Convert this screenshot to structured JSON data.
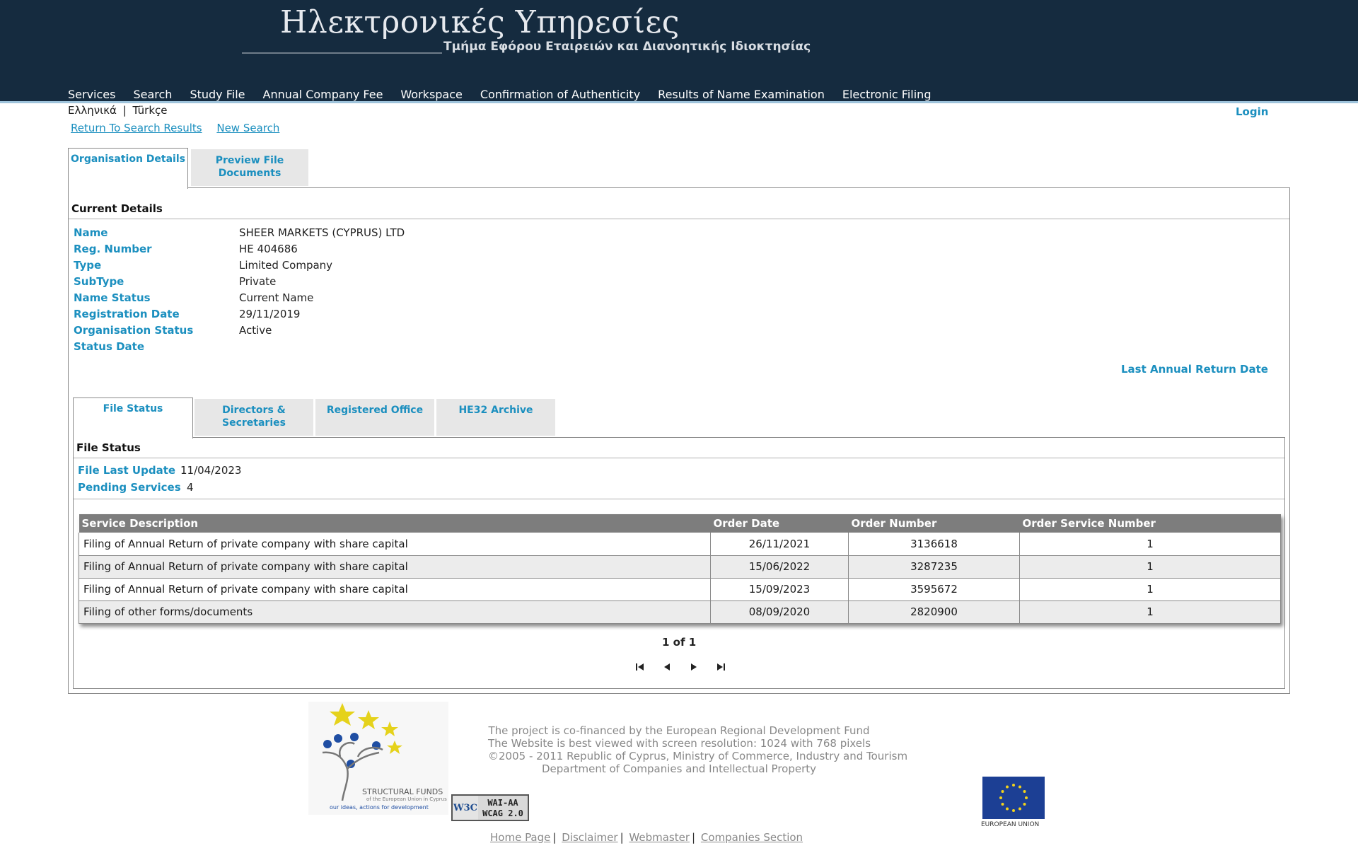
{
  "header": {
    "title": "Ηλεκτρονικές Υπηρεσίες",
    "subtitle": "Τμήμα Εφόρου Εταιρειών και Διανοητικής Ιδιοκτησίας",
    "nav": [
      "Services",
      "Search",
      "Study File",
      "Annual Company Fee",
      "Workspace",
      "Confirmation of Authenticity",
      "Results of Name Examination",
      "Electronic Filing"
    ]
  },
  "lang": {
    "greek": "Ελληνικά",
    "sep": "|",
    "turkish": "Türkçe"
  },
  "login": "Login",
  "links": {
    "return": "Return To Search Results",
    "new_search": "New Search"
  },
  "outer_tabs": {
    "org_details": "Organisation Details",
    "preview_docs_1": "Preview File",
    "preview_docs_2": "Documents"
  },
  "current_details": {
    "heading": "Current Details",
    "labels": [
      "Name",
      "Reg. Number",
      "Type",
      "SubType",
      "Name Status",
      "Registration Date",
      "Organisation Status",
      "Status Date"
    ],
    "values": [
      "SHEER MARKETS (CYPRUS) LTD",
      "HE 404686",
      "Limited Company",
      "Private",
      "Current Name",
      "29/11/2019",
      "Active",
      ""
    ],
    "last_annual_return": "Last Annual Return Date"
  },
  "inner_tabs": [
    "File Status",
    "Directors & Secretaries",
    "Registered Office",
    "HE32 Archive"
  ],
  "file_status": {
    "heading": "File Status",
    "last_update_label": "File Last Update",
    "last_update_value": "11/04/2023",
    "pending_label": "Pending Services",
    "pending_value": "4"
  },
  "table": {
    "headers": [
      "Service Description",
      "Order Date",
      "Order Number",
      "Order Service Number"
    ],
    "rows": [
      [
        "Filing of Annual Return of private company with share capital",
        "26/11/2021",
        "3136618",
        "1"
      ],
      [
        "Filing of Annual Return of private company with share capital",
        "15/06/2022",
        "3287235",
        "1"
      ],
      [
        "Filing of Annual Return of private company with share capital",
        "15/09/2023",
        "3595672",
        "1"
      ],
      [
        "Filing of other forms/documents",
        "08/09/2020",
        "2820900",
        "1"
      ]
    ]
  },
  "pager": {
    "text": "1 of 1"
  },
  "footer": {
    "lines": [
      "The project is co-financed by the European Regional Development Fund",
      "The Website is best viewed with screen resolution: 1024 with 768 pixels",
      "©2005 - 2011 Republic of Cyprus, Ministry of Commerce, Industry and Tourism",
      "Department of Companies and Intellectual Property"
    ],
    "links": [
      "Home Page",
      "Disclaimer",
      "Webmaster",
      "Companies Section"
    ],
    "sf_title": "STRUCTURAL FUNDS",
    "sf_sub": "of the European Union in Cyprus",
    "sf_tagline": "our ideas, actions for development",
    "w3c": "W3C",
    "wai_1": "WAI-AA",
    "wai_2": "WCAG 2.0",
    "eu_label": "EUROPEAN UNION"
  },
  "colors": {
    "header_bg": "#152b3f",
    "accent": "#1b8fbf",
    "table_header": "#7d7d7d"
  }
}
